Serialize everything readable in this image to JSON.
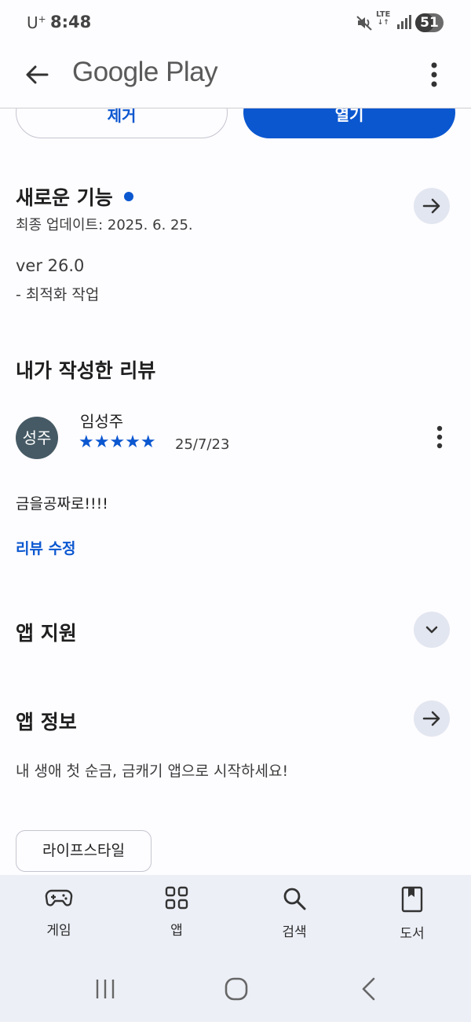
{
  "status": {
    "carrier": "U",
    "carrier_sup": "+",
    "time": "8:48",
    "network": "LTE",
    "battery": "51"
  },
  "appbar": {
    "title": "Google Play"
  },
  "top_buttons": {
    "remove_label": "제거",
    "open_label": "열기"
  },
  "whats_new": {
    "title": "새로운 기능",
    "updated": "최종 업데이트: 2025. 6. 25.",
    "version": "ver 26.0",
    "notes": "- 최적화 작업"
  },
  "my_review": {
    "title": "내가 작성한 리뷰",
    "avatar_text": "성주",
    "reviewer": "임성주",
    "rating": 5,
    "stars": "★★★★★",
    "date": "25/7/23",
    "text": "금을공짜로!!!!",
    "edit_label": "리뷰 수정"
  },
  "app_support": {
    "title": "앱 지원"
  },
  "app_info": {
    "title": "앱 정보",
    "description": "내 생애 첫 순금, 금캐기 앱으로 시작하세요!",
    "category_chip": "라이프스타일"
  },
  "bottom_nav": {
    "items": [
      {
        "label": "게임",
        "icon": "gamepad-icon"
      },
      {
        "label": "앱",
        "icon": "apps-grid-icon"
      },
      {
        "label": "검색",
        "icon": "search-icon"
      },
      {
        "label": "도서",
        "icon": "book-icon"
      }
    ]
  },
  "colors": {
    "accent": "#0b57d0",
    "background": "#fdfcff",
    "nav_background": "#eceff6",
    "circle_button": "#e2e6f0",
    "avatar": "#455a64"
  }
}
